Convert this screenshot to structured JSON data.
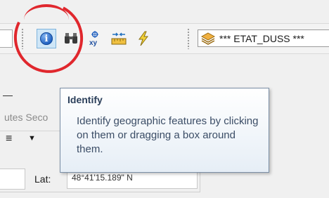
{
  "toolbar": {
    "tools": [
      {
        "id": "identify",
        "icon": "identify-icon",
        "glyph": "i",
        "active": true
      },
      {
        "id": "find",
        "icon": "binoculars-icon",
        "glyph": "🔭"
      },
      {
        "id": "goto_xy",
        "icon": "go-to-xy-icon",
        "glyph": "xy"
      },
      {
        "id": "measure",
        "icon": "measure-icon",
        "glyph": "📏"
      },
      {
        "id": "hyperlink",
        "icon": "lightning-icon",
        "glyph": "⚡"
      }
    ],
    "layer_combo": {
      "icon": "layer-icon",
      "text": "*** ETAT_DUSS ***"
    }
  },
  "tooltip": {
    "title": "Identify",
    "body": "Identify geographic features by clicking on them or dragging a box around them."
  },
  "panel": {
    "label": "utes Seco",
    "menu_glyph": "≡",
    "dropdown_glyph": "▼",
    "lat_label": "Lat:",
    "lat_value": "48°41'15.189\" N"
  },
  "colors": {
    "annotation": "#e0272d",
    "tooltip_border": "#7b8fa6",
    "accent": "#1f5fbf"
  }
}
